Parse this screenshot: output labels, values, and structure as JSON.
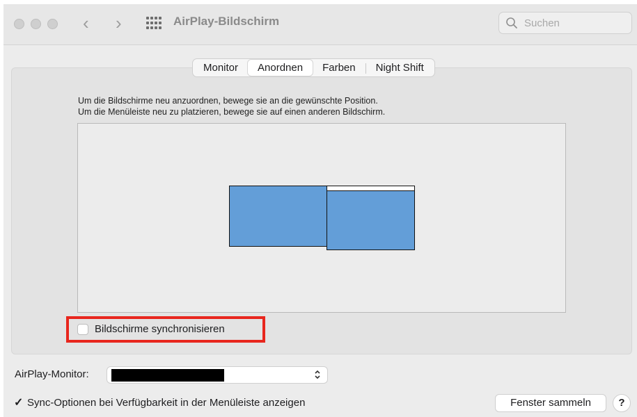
{
  "window": {
    "title": "AirPlay-Bildschirm",
    "back_glyph": "‹",
    "forward_glyph": "›",
    "grid_icon": "grid-icon",
    "search": {
      "placeholder": "Suchen",
      "icon": "search-icon"
    }
  },
  "tabs": [
    {
      "label": "Monitor",
      "selected": false
    },
    {
      "label": "Anordnen",
      "selected": true
    },
    {
      "label": "Farben",
      "selected": false
    },
    {
      "label": "Night Shift",
      "selected": false
    }
  ],
  "arrange": {
    "instruction_line1": "Um die Bildschirme neu anzuordnen, bewege sie an die gewünschte Position.",
    "instruction_line2": "Um die Menüleiste neu zu platzieren, bewege sie auf einen anderen Bildschirm.",
    "display_color": "#639ed8",
    "sync_checkbox": {
      "label": "Bildschirme synchronisieren",
      "checked": false
    },
    "highlight_color": "#e8261d"
  },
  "airplay_monitor": {
    "label": "AirPlay-Monitor:",
    "selected_value_redacted": true
  },
  "menu_bar_option": {
    "checked": true,
    "check_glyph": "✓",
    "label": "Sync-Optionen bei Verfügbarkeit in der Menüleiste anzeigen"
  },
  "buttons": {
    "collect_windows": "Fenster sammeln",
    "help": "?"
  }
}
